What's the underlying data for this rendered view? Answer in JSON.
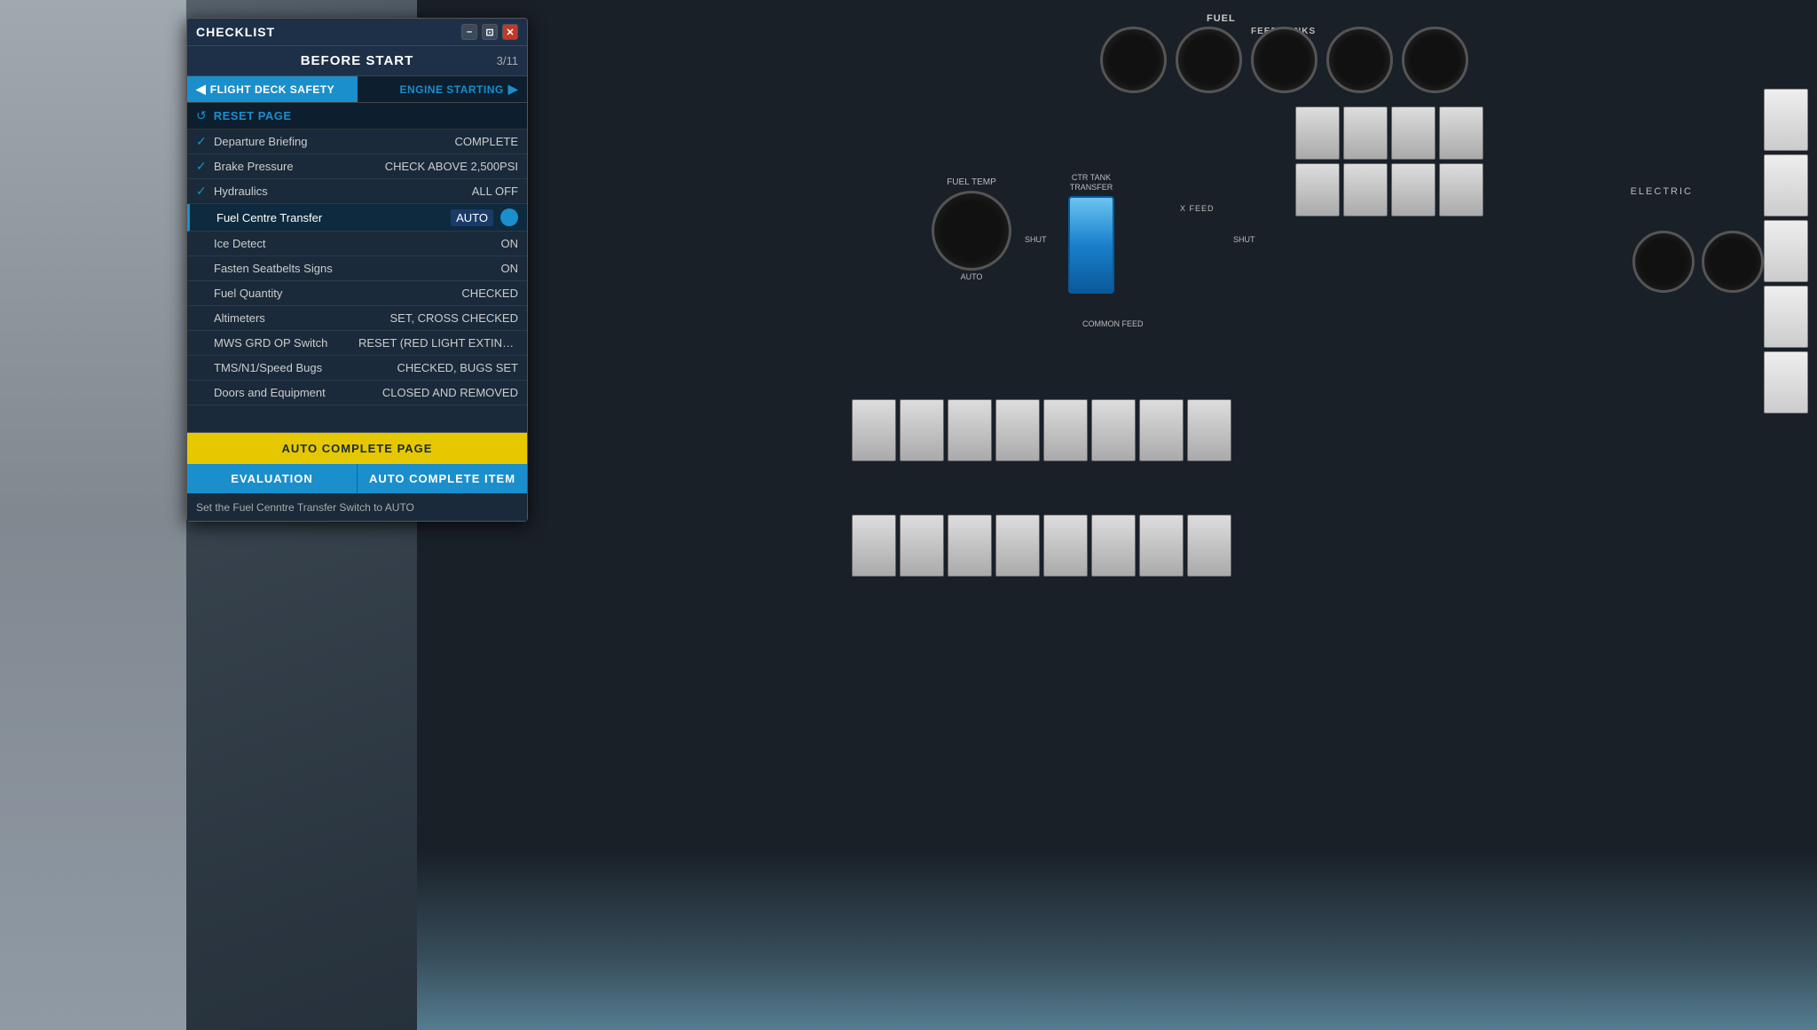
{
  "checklist": {
    "title": "CHECKLIST",
    "controls": {
      "minimize": "–",
      "restore": "⊡",
      "close": "✕"
    },
    "section": "BEFORE START",
    "page": "3/11",
    "nav": {
      "left_label": "FLIGHT DECK SAFETY",
      "right_label": "ENGINE STARTING"
    },
    "reset": "RESET PAGE",
    "items": [
      {
        "checked": true,
        "name": "Departure Briefing",
        "value": "COMPLETE",
        "highlighted": false
      },
      {
        "checked": true,
        "name": "Brake Pressure",
        "value": "CHECK ABOVE 2,500PSI",
        "highlighted": false
      },
      {
        "checked": true,
        "name": "Hydraulics",
        "value": "ALL OFF",
        "highlighted": false
      },
      {
        "checked": false,
        "name": "Fuel Centre Transfer",
        "value": "AUTO",
        "highlighted": true
      },
      {
        "checked": false,
        "name": "Ice Detect",
        "value": "ON",
        "highlighted": false
      },
      {
        "checked": false,
        "name": "Fasten Seatbelts Signs",
        "value": "ON",
        "highlighted": false
      },
      {
        "checked": false,
        "name": "Fuel Quantity",
        "value": "CHECKED",
        "highlighted": false
      },
      {
        "checked": false,
        "name": "Altimeters",
        "value": "SET, CROSS CHECKED",
        "highlighted": false
      },
      {
        "checked": false,
        "name": "MWS GRD OP Switch",
        "value": "RESET (RED LIGHT EXTINGUIS...",
        "highlighted": false
      },
      {
        "checked": false,
        "name": "TMS/N1/Speed Bugs",
        "value": "CHECKED, BUGS SET",
        "highlighted": false
      },
      {
        "checked": false,
        "name": "Doors and Equipment",
        "value": "CLOSED AND REMOVED",
        "highlighted": false
      }
    ],
    "auto_complete_label": "AUTO COMPLETE PAGE",
    "evaluation_label": "EVALUATION",
    "auto_complete_item_label": "AUTO COMPLETE ITEM",
    "instruction": "Set the Fuel Cenntre Transfer Switch to AUTO"
  },
  "cockpit": {
    "fuel_label": "FUEL",
    "feed_tanks_label": "FEED TANKS",
    "electric_label": "ELECTRIC",
    "fuel_temp_label": "FUEL TEMP",
    "ctr_tank_label": "CTR TANK TRANSFER"
  }
}
